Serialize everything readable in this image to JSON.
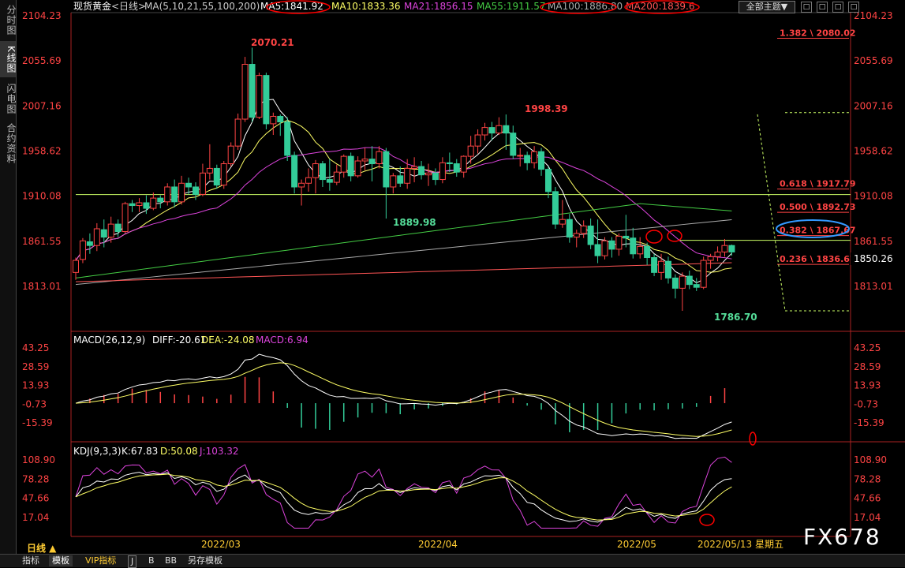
{
  "sidebar": {
    "tabs": [
      "分时图",
      "K线图",
      "闪电图",
      "合约资料"
    ],
    "active": 1
  },
  "top_controls": {
    "theme_label": "全部主题▼",
    "window_buttons": [
      "□",
      "□",
      "□",
      "□"
    ]
  },
  "header": {
    "symbol": "现货黄金",
    "period": "<日线>",
    "ma_params": "MA(5,10,21,55,100,200)",
    "ma_values": [
      {
        "text": "MA5:1841.92",
        "color": "#ffffff"
      },
      {
        "text": "MA10:1833.36",
        "color": "#ffff66"
      },
      {
        "text": "MA21:1856.15",
        "color": "#dd44dd"
      },
      {
        "text": "MA55:1911.57",
        "color": "#44cc44"
      },
      {
        "text": "MA100:1886.80",
        "color": "#aaaaaa"
      },
      {
        "text": "MA200:1839.6",
        "color": "#ff5555"
      }
    ]
  },
  "price_axis": {
    "ticks": [
      "2104.23",
      "2055.69",
      "2007.16",
      "1958.62",
      "1910.08",
      "1861.55",
      "1813.01"
    ],
    "current": "1850.26"
  },
  "annotations": {
    "high": "2070.21",
    "mid_high": "1998.39",
    "mid_low": "1889.98",
    "low": "1786.70"
  },
  "fibonacci": [
    {
      "text": "1.382 \\ 2080.02",
      "price": 2080.02
    },
    {
      "text": "0.618 \\ 1917.79",
      "price": 1917.79
    },
    {
      "text": "0.500 \\ 1892.73",
      "price": 1892.73
    },
    {
      "text": "0.382 \\ 1867.67",
      "price": 1867.67
    },
    {
      "text": "0.236 \\ 1836.67",
      "price": 1836.67
    }
  ],
  "macd": {
    "label": "MACD(26,12,9)",
    "diff": "DIFF:-20.61",
    "dea": "DEA:-24.08",
    "macd": "MACD:6.94",
    "ticks": [
      "43.25",
      "28.59",
      "13.93",
      "-0.73",
      "-15.39"
    ]
  },
  "kdj": {
    "label": "KDJ(9,3,3)",
    "k": "K:67.83",
    "d": "D:50.08",
    "j": "J:103.32",
    "ticks": [
      "108.90",
      "78.28",
      "47.66",
      "17.04"
    ]
  },
  "x_axis": {
    "labels": [
      "2022/03",
      "2022/04",
      "2022/05"
    ],
    "cursor": "2022/05/13 星期五"
  },
  "bottom_tabs": [
    "指标",
    "模板",
    "VIP指标",
    "J",
    "B",
    "BB",
    "另存模板"
  ],
  "period_label": "日线 ▲",
  "watermark": "FX678",
  "chart_data": {
    "type": "candlestick",
    "ylim": [
      1786.7,
      2104.23
    ],
    "candles": [
      [
        1828,
        1841,
        1820,
        1844
      ],
      [
        1842,
        1862,
        1838,
        1865
      ],
      [
        1861,
        1857,
        1848,
        1870
      ],
      [
        1857,
        1875,
        1851,
        1881
      ],
      [
        1874,
        1866,
        1855,
        1885
      ],
      [
        1866,
        1880,
        1860,
        1888
      ],
      [
        1880,
        1872,
        1866,
        1885
      ],
      [
        1872,
        1902,
        1870,
        1904
      ],
      [
        1902,
        1900,
        1893,
        1906
      ],
      [
        1900,
        1903,
        1893,
        1908
      ],
      [
        1903,
        1897,
        1891,
        1911
      ],
      [
        1897,
        1908,
        1895,
        1914
      ],
      [
        1908,
        1904,
        1897,
        1911
      ],
      [
        1904,
        1920,
        1900,
        1924
      ],
      [
        1920,
        1904,
        1898,
        1928
      ],
      [
        1904,
        1924,
        1901,
        1932
      ],
      [
        1924,
        1920,
        1912,
        1930
      ],
      [
        1920,
        1912,
        1906,
        1925
      ],
      [
        1912,
        1935,
        1910,
        1945
      ],
      [
        1935,
        1940,
        1928,
        1966
      ],
      [
        1940,
        1922,
        1918,
        1944
      ],
      [
        1922,
        1945,
        1918,
        1948
      ],
      [
        1945,
        1964,
        1942,
        1968
      ],
      [
        1964,
        1993,
        1960,
        1999
      ],
      [
        1993,
        2052,
        1990,
        2060
      ],
      [
        2052,
        1995,
        1990,
        2070
      ],
      [
        1995,
        2040,
        1993,
        2043
      ],
      [
        2040,
        1988,
        1982,
        2043
      ],
      [
        1988,
        1996,
        1976,
        2000
      ],
      [
        1996,
        1990,
        1975,
        1998
      ],
      [
        1990,
        1954,
        1948,
        1995
      ],
      [
        1954,
        1920,
        1913,
        1958
      ],
      [
        1920,
        1924,
        1900,
        1928
      ],
      [
        1924,
        1930,
        1915,
        1940
      ],
      [
        1930,
        1945,
        1913,
        1949
      ],
      [
        1945,
        1928,
        1920,
        1948
      ],
      [
        1928,
        1925,
        1916,
        1950
      ],
      [
        1925,
        1936,
        1922,
        1944
      ],
      [
        1936,
        1953,
        1930,
        1955
      ],
      [
        1953,
        1932,
        1926,
        1957
      ],
      [
        1932,
        1948,
        1930,
        1953
      ],
      [
        1948,
        1950,
        1938,
        1962
      ],
      [
        1950,
        1945,
        1926,
        1964
      ],
      [
        1945,
        1958,
        1940,
        1964
      ],
      [
        1958,
        1920,
        1886,
        1962
      ],
      [
        1920,
        1932,
        1913,
        1935
      ],
      [
        1932,
        1924,
        1920,
        1942
      ],
      [
        1924,
        1940,
        1918,
        1950
      ],
      [
        1940,
        1942,
        1925,
        1952
      ],
      [
        1942,
        1933,
        1928,
        1948
      ],
      [
        1933,
        1935,
        1921,
        1945
      ],
      [
        1935,
        1928,
        1922,
        1940
      ],
      [
        1928,
        1946,
        1924,
        1952
      ],
      [
        1946,
        1945,
        1936,
        1957
      ],
      [
        1945,
        1936,
        1931,
        1950
      ],
      [
        1936,
        1953,
        1930,
        1954
      ],
      [
        1953,
        1964,
        1945,
        1975
      ],
      [
        1964,
        1976,
        1956,
        1982
      ],
      [
        1976,
        1984,
        1970,
        1989
      ],
      [
        1984,
        1978,
        1970,
        1990
      ],
      [
        1978,
        1986,
        1976,
        1995
      ],
      [
        1986,
        1978,
        1960,
        1998
      ],
      [
        1978,
        1954,
        1950,
        1986
      ],
      [
        1954,
        1954,
        1942,
        1962
      ],
      [
        1954,
        1946,
        1938,
        1958
      ],
      [
        1946,
        1958,
        1940,
        1964
      ],
      [
        1958,
        1939,
        1932,
        1962
      ],
      [
        1939,
        1915,
        1908,
        1942
      ],
      [
        1915,
        1880,
        1875,
        1920
      ],
      [
        1880,
        1885,
        1876,
        1906
      ],
      [
        1885,
        1866,
        1860,
        1891
      ],
      [
        1866,
        1870,
        1855,
        1874
      ],
      [
        1870,
        1878,
        1865,
        1884
      ],
      [
        1878,
        1858,
        1853,
        1886
      ],
      [
        1858,
        1846,
        1838,
        1885
      ],
      [
        1846,
        1862,
        1842,
        1866
      ],
      [
        1862,
        1853,
        1844,
        1866
      ],
      [
        1853,
        1867,
        1846,
        1870
      ],
      [
        1867,
        1865,
        1855,
        1890
      ],
      [
        1865,
        1848,
        1843,
        1876
      ],
      [
        1848,
        1856,
        1843,
        1866
      ],
      [
        1856,
        1844,
        1836,
        1860
      ],
      [
        1844,
        1828,
        1824,
        1848
      ],
      [
        1828,
        1840,
        1820,
        1848
      ],
      [
        1840,
        1822,
        1816,
        1845
      ],
      [
        1822,
        1811,
        1800,
        1826
      ],
      [
        1811,
        1824,
        1786.7,
        1828
      ],
      [
        1824,
        1815,
        1810,
        1830
      ],
      [
        1815,
        1812,
        1808,
        1822
      ],
      [
        1812,
        1841,
        1810,
        1845
      ],
      [
        1841,
        1845,
        1832,
        1848
      ],
      [
        1845,
        1850,
        1840,
        1856
      ],
      [
        1850,
        1857,
        1845,
        1864
      ],
      [
        1857,
        1850,
        1846,
        1858
      ]
    ]
  }
}
